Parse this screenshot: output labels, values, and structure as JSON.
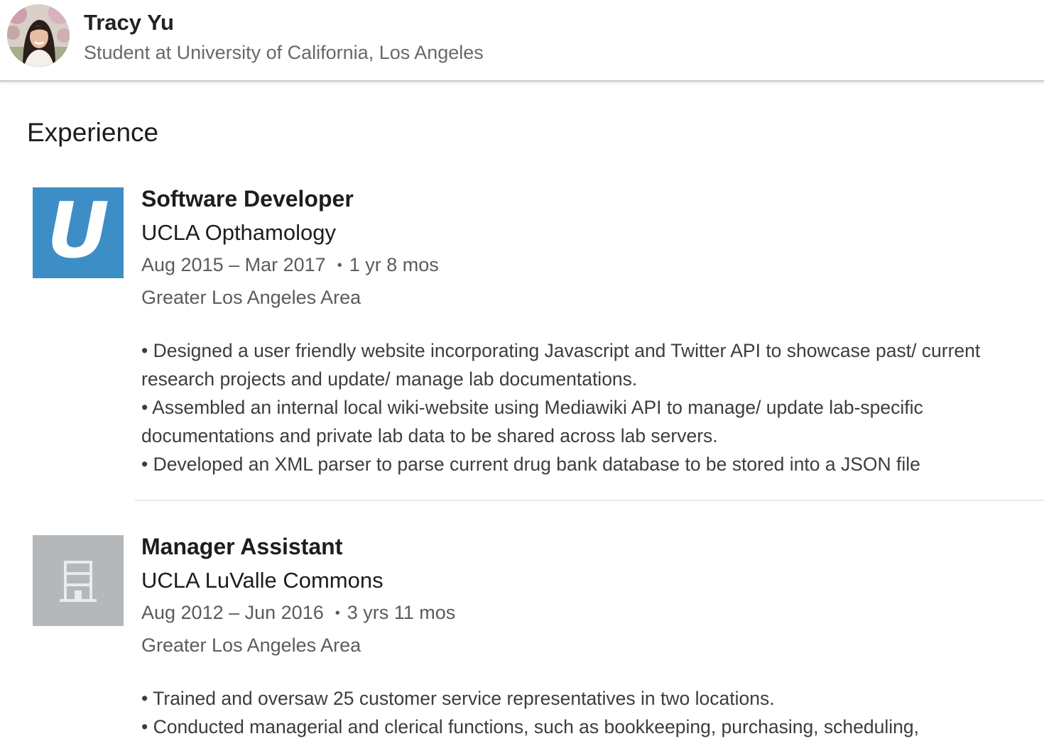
{
  "profile": {
    "name": "Tracy Yu",
    "headline": "Student at University of California, Los Angeles"
  },
  "section": {
    "title": "Experience"
  },
  "experiences": [
    {
      "title": "Software Developer",
      "company": "UCLA Opthamology",
      "logo_letter": "U",
      "logo_color": "#3d8ec7",
      "date_range": "Aug 2015 – Mar 2017",
      "separator": "•",
      "duration": "1 yr 8 mos",
      "location": "Greater Los Angeles Area",
      "description": [
        "• Designed a user friendly website incorporating Javascript and Twitter API to showcase past/ current research projects and update/ manage lab documentations.",
        "• Assembled an internal local wiki-website using Mediawiki API to manage/ update lab-specific documentations and private lab data to be shared across lab servers.",
        "• Developed an XML parser to parse current drug bank database to be stored into a JSON file"
      ]
    },
    {
      "title": "Manager Assistant",
      "company": "UCLA LuValle Commons",
      "logo_icon": "building-icon",
      "logo_color": "#b5b8bb",
      "date_range": "Aug 2012 – Jun 2016",
      "separator": "•",
      "duration": "3 yrs 11 mos",
      "location": "Greater Los Angeles Area",
      "description": [
        "• Trained and oversaw 25 customer service representatives in two locations.",
        "• Conducted managerial and clerical functions, such as bookkeeping, purchasing, scheduling,"
      ]
    }
  ],
  "colors": {
    "accent_logo_blue": "#3d8ec7",
    "secondary_text": "#595c5f",
    "divider": "#e6e9ec"
  }
}
